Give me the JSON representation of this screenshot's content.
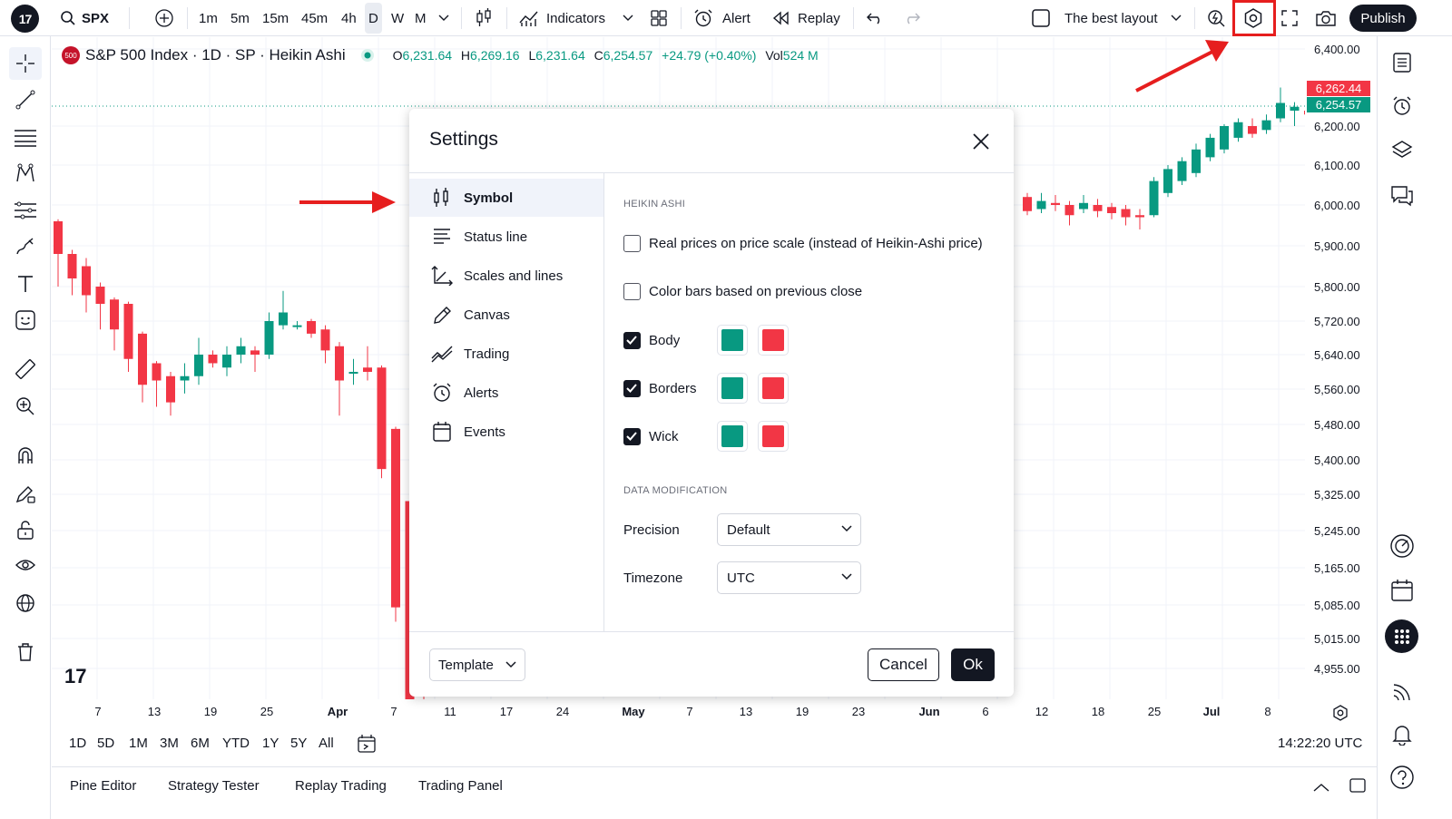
{
  "toolbar": {
    "logo": "17",
    "symbol": "SPX",
    "timeframes": [
      "1m",
      "5m",
      "15m",
      "45m",
      "4h",
      "D",
      "W",
      "M"
    ],
    "active_timeframe": "D",
    "indicators_label": "Indicators",
    "alert_label": "Alert",
    "replay_label": "Replay",
    "layout_name": "The best layout",
    "publish_label": "Publish"
  },
  "legend": {
    "symbol_badge": "500",
    "title": "S&P 500 Index · 1D · SP · Heikin Ashi",
    "o_key": "O",
    "o_val": "6,231.64",
    "h_key": "H",
    "h_val": "6,269.16",
    "l_key": "L",
    "l_val": "6,231.64",
    "c_key": "C",
    "c_val": "6,254.57",
    "change": "+24.79 (+0.40%)",
    "vol_key": "Vol",
    "vol_val": "524 M"
  },
  "price_scale": [
    "6,400.00",
    "6,200.00",
    "6,100.00",
    "6,000.00",
    "5,900.00",
    "5,800.00",
    "5,720.00",
    "5,640.00",
    "5,560.00",
    "5,480.00",
    "5,400.00",
    "5,325.00",
    "5,245.00",
    "5,165.00",
    "5,085.00",
    "5,015.00",
    "4,955.00"
  ],
  "price_badges": {
    "high": "6,262.44",
    "last": "6,254.57"
  },
  "time_scale": [
    {
      "t": "7",
      "b": false
    },
    {
      "t": "13",
      "b": false
    },
    {
      "t": "19",
      "b": false
    },
    {
      "t": "25",
      "b": false
    },
    {
      "t": "Apr",
      "b": true
    },
    {
      "t": "7",
      "b": false
    },
    {
      "t": "11",
      "b": false
    },
    {
      "t": "17",
      "b": false
    },
    {
      "t": "24",
      "b": false
    },
    {
      "t": "May",
      "b": true
    },
    {
      "t": "7",
      "b": false
    },
    {
      "t": "13",
      "b": false
    },
    {
      "t": "19",
      "b": false
    },
    {
      "t": "23",
      "b": false
    },
    {
      "t": "Jun",
      "b": true
    },
    {
      "t": "6",
      "b": false
    },
    {
      "t": "12",
      "b": false
    },
    {
      "t": "18",
      "b": false
    },
    {
      "t": "25",
      "b": false
    },
    {
      "t": "Jul",
      "b": true
    },
    {
      "t": "8",
      "b": false
    }
  ],
  "ranges": [
    "1D",
    "5D",
    "1M",
    "3M",
    "6M",
    "YTD",
    "1Y",
    "5Y",
    "All"
  ],
  "clock": "14:22:20 UTC",
  "bottom_tabs": [
    "Pine Editor",
    "Strategy Tester",
    "Replay Trading",
    "Trading Panel"
  ],
  "watermark": "17",
  "colors": {
    "up": "#089981",
    "down": "#f23645",
    "highlight": "#e61e1e"
  },
  "dialog": {
    "title": "Settings",
    "nav": [
      {
        "label": "Symbol",
        "icon": "candles-icon"
      },
      {
        "label": "Status line",
        "icon": "status-line-icon"
      },
      {
        "label": "Scales and lines",
        "icon": "scales-icon"
      },
      {
        "label": "Canvas",
        "icon": "pencil-icon"
      },
      {
        "label": "Trading",
        "icon": "trading-icon"
      },
      {
        "label": "Alerts",
        "icon": "alarm-clock-icon"
      },
      {
        "label": "Events",
        "icon": "calendar-icon"
      }
    ],
    "section_heikin": "HEIKIN ASHI",
    "real_prices_label": "Real prices on price scale (instead of Heikin-Ashi price)",
    "real_prices_checked": false,
    "color_bars_label": "Color bars based on previous close",
    "color_bars_checked": false,
    "body_label": "Body",
    "body_checked": true,
    "borders_label": "Borders",
    "borders_checked": true,
    "wick_label": "Wick",
    "wick_checked": true,
    "section_data": "DATA MODIFICATION",
    "precision_label": "Precision",
    "precision_value": "Default",
    "timezone_label": "Timezone",
    "timezone_value": "UTC",
    "template_label": "Template",
    "cancel_label": "Cancel",
    "ok_label": "Ok"
  },
  "candles_left": [
    {
      "o": 5960,
      "c": 5880,
      "h": 5965,
      "l": 5800
    },
    {
      "o": 5880,
      "c": 5820,
      "h": 5890,
      "l": 5780
    },
    {
      "o": 5850,
      "c": 5780,
      "h": 5870,
      "l": 5740
    },
    {
      "o": 5800,
      "c": 5760,
      "h": 5810,
      "l": 5700
    },
    {
      "o": 5770,
      "c": 5700,
      "h": 5775,
      "l": 5650
    },
    {
      "o": 5760,
      "c": 5630,
      "h": 5765,
      "l": 5600
    },
    {
      "o": 5690,
      "c": 5570,
      "h": 5695,
      "l": 5530
    },
    {
      "o": 5620,
      "c": 5580,
      "h": 5625,
      "l": 5520
    },
    {
      "o": 5590,
      "c": 5530,
      "h": 5600,
      "l": 5500
    },
    {
      "o": 5580,
      "c": 5590,
      "h": 5620,
      "l": 5550
    },
    {
      "o": 5590,
      "c": 5640,
      "h": 5680,
      "l": 5570
    },
    {
      "o": 5640,
      "c": 5620,
      "h": 5650,
      "l": 5610
    },
    {
      "o": 5610,
      "c": 5640,
      "h": 5660,
      "l": 5590
    },
    {
      "o": 5640,
      "c": 5660,
      "h": 5680,
      "l": 5620
    },
    {
      "o": 5650,
      "c": 5640,
      "h": 5660,
      "l": 5600
    },
    {
      "o": 5640,
      "c": 5720,
      "h": 5740,
      "l": 5630
    },
    {
      "o": 5710,
      "c": 5740,
      "h": 5790,
      "l": 5700
    },
    {
      "o": 5710,
      "c": 5710,
      "h": 5720,
      "l": 5700
    },
    {
      "o": 5720,
      "c": 5690,
      "h": 5725,
      "l": 5680
    },
    {
      "o": 5700,
      "c": 5650,
      "h": 5710,
      "l": 5620
    },
    {
      "o": 5660,
      "c": 5580,
      "h": 5670,
      "l": 5500
    },
    {
      "o": 5600,
      "c": 5600,
      "h": 5630,
      "l": 5570
    },
    {
      "o": 5610,
      "c": 5600,
      "h": 5660,
      "l": 5580
    },
    {
      "o": 5610,
      "c": 5380,
      "h": 5615,
      "l": 5360
    },
    {
      "o": 5470,
      "c": 5080,
      "h": 5475,
      "l": 5050
    },
    {
      "o": 5310,
      "c": 4860,
      "h": 5315,
      "l": 4820
    },
    {
      "o": 5200,
      "c": 5040,
      "h": 5260,
      "l": 4750
    }
  ],
  "candles_right": [
    {
      "o": 6020,
      "c": 5985,
      "h": 6030,
      "l": 5975
    },
    {
      "o": 5990,
      "c": 6010,
      "h": 6030,
      "l": 5980
    },
    {
      "o": 6005,
      "c": 6000,
      "h": 6025,
      "l": 5985
    },
    {
      "o": 6000,
      "c": 5975,
      "h": 6010,
      "l": 5950
    },
    {
      "o": 5990,
      "c": 6005,
      "h": 6025,
      "l": 5980
    },
    {
      "o": 6000,
      "c": 5985,
      "h": 6015,
      "l": 5970
    },
    {
      "o": 5995,
      "c": 5980,
      "h": 6005,
      "l": 5965
    },
    {
      "o": 5990,
      "c": 5970,
      "h": 6000,
      "l": 5950
    },
    {
      "o": 5975,
      "c": 5970,
      "h": 5990,
      "l": 5940
    },
    {
      "o": 5975,
      "c": 6060,
      "h": 6070,
      "l": 5970
    },
    {
      "o": 6030,
      "c": 6090,
      "h": 6100,
      "l": 6020
    },
    {
      "o": 6060,
      "c": 6110,
      "h": 6120,
      "l": 6050
    },
    {
      "o": 6080,
      "c": 6140,
      "h": 6155,
      "l": 6070
    },
    {
      "o": 6120,
      "c": 6170,
      "h": 6180,
      "l": 6110
    },
    {
      "o": 6140,
      "c": 6200,
      "h": 6205,
      "l": 6130
    },
    {
      "o": 6170,
      "c": 6210,
      "h": 6220,
      "l": 6160
    },
    {
      "o": 6200,
      "c": 6180,
      "h": 6220,
      "l": 6170
    },
    {
      "o": 6190,
      "c": 6215,
      "h": 6230,
      "l": 6180
    },
    {
      "o": 6220,
      "c": 6260,
      "h": 6300,
      "l": 6210
    },
    {
      "o": 6240,
      "c": 6250,
      "h": 6262,
      "l": 6200
    },
    {
      "o": 6240,
      "c": 6230,
      "h": 6245,
      "l": 6220
    },
    {
      "o": 6231,
      "c": 6255,
      "h": 6269,
      "l": 6231
    }
  ]
}
